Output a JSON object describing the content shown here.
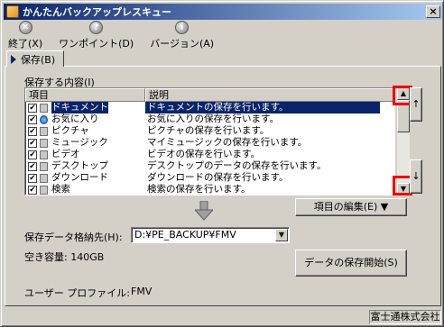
{
  "window": {
    "title": "かんたんバックアップレスキュー",
    "close_label": "×"
  },
  "toolbar": [
    {
      "icon": "exit-icon",
      "glyph": "✕",
      "label": "終了(X)"
    },
    {
      "icon": "help-icon",
      "glyph": "?",
      "label": "ワンポイント(D)"
    },
    {
      "icon": "info-icon",
      "glyph": "i",
      "label": "バージョン(A)"
    }
  ],
  "tab": {
    "label": "保存(B)"
  },
  "content_group_label": "保存する内容(I)",
  "list": {
    "columns": [
      "項目",
      "説明"
    ],
    "rows": [
      {
        "name": "ドキュメント",
        "desc": "ドキュメントの保存を行います。",
        "checked": true,
        "selected": true
      },
      {
        "name": "お気に入り",
        "desc": "お気に入りの保存を行います。",
        "checked": true,
        "selected": false
      },
      {
        "name": "ピクチャ",
        "desc": "ピクチャの保存を行います。",
        "checked": true,
        "selected": false
      },
      {
        "name": "ミュージック",
        "desc": "マイミュージックの保存を行います。",
        "checked": true,
        "selected": false
      },
      {
        "name": "ビデオ",
        "desc": "ビデオの保存を行います。",
        "checked": true,
        "selected": false
      },
      {
        "name": "デスクトップ",
        "desc": "デスクトップのデータの保存を行います。",
        "checked": true,
        "selected": false
      },
      {
        "name": "ダウンロード",
        "desc": "ダウンロードの保存を行います。",
        "checked": true,
        "selected": false
      },
      {
        "name": "検索",
        "desc": "検索の保存を行います。",
        "checked": true,
        "selected": false
      }
    ]
  },
  "move_up_label": "↑",
  "move_down_label": "↓",
  "edit_items_button": "項目の編集(E) ▼",
  "destination": {
    "label": "保存データ格納先(H):",
    "value": "D:¥PE_BACKUP¥FMV"
  },
  "free_space": "空き容量: 140GB",
  "start_button": "データの保存開始(S)",
  "profile": {
    "label": "ユーザー プロファイル:",
    "value": "FMV"
  },
  "status": {
    "company": "富士通株式会社"
  }
}
